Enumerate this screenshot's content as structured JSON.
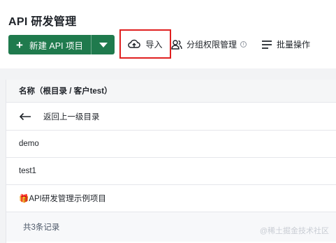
{
  "header": {
    "title": "API 研发管理",
    "new_button_label": "新建 API 项目",
    "import_label": "导入",
    "permissions_label": "分组权限管理",
    "batch_label": "批量操作"
  },
  "table": {
    "column_header": "名称（根目录 / 客户test）",
    "back_label": "返回上一级目录",
    "rows": [
      "demo",
      "test1",
      "🎁API研发管理示例项目"
    ],
    "footer": "共3条记录"
  },
  "watermark": "@稀土掘金技术社区",
  "colors": {
    "primary": "#1f7a4d",
    "highlight": "#e02020"
  },
  "icons": [
    "plus-icon",
    "caret-down-icon",
    "cloud-upload-icon",
    "user-group-icon",
    "info-icon",
    "list-icon",
    "arrow-left-icon",
    "gift-icon"
  ]
}
